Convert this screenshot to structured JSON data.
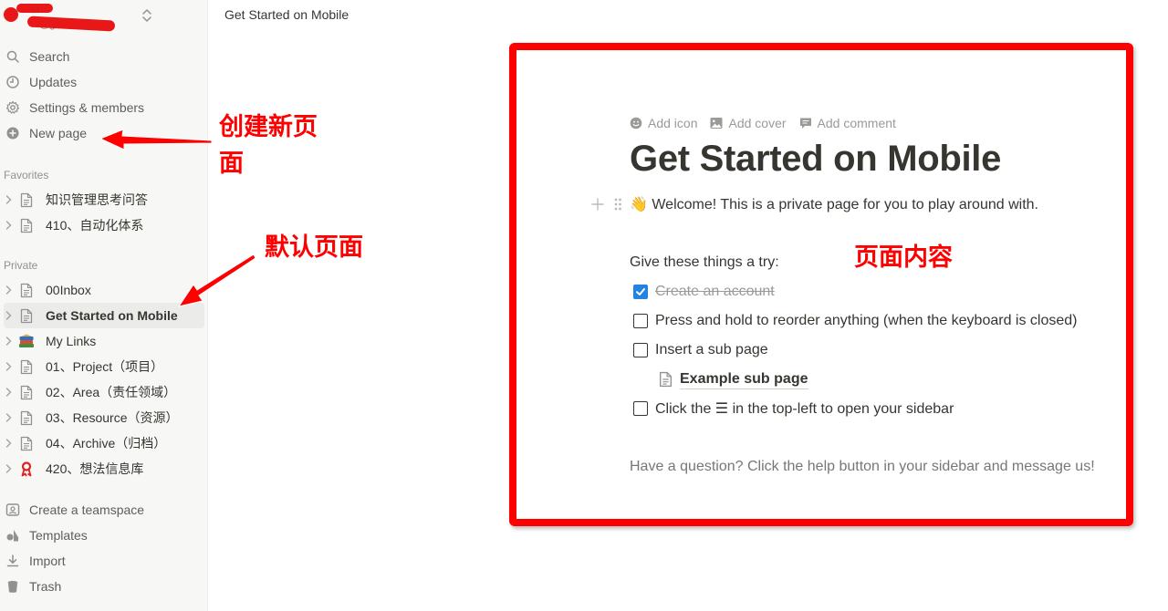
{
  "workspace": {
    "name": "M",
    "email": "...@g..."
  },
  "sidebar": {
    "nav": [
      {
        "label": "Search",
        "icon": "search-icon"
      },
      {
        "label": "Updates",
        "icon": "clock-icon"
      },
      {
        "label": "Settings & members",
        "icon": "gear-icon"
      },
      {
        "label": "New page",
        "icon": "plus-circle-icon"
      }
    ],
    "favorites_label": "Favorites",
    "favorites": [
      {
        "label": "知识管理思考问答",
        "icon": "page-icon"
      },
      {
        "label": "410、自动化体系",
        "icon": "page-icon"
      }
    ],
    "private_label": "Private",
    "private": [
      {
        "label": "00Inbox",
        "icon": "page-icon"
      },
      {
        "label": "Get Started on Mobile",
        "icon": "page-icon",
        "active": true
      },
      {
        "label": "My Links",
        "icon": "books-icon"
      },
      {
        "label": "01、Project（项目）",
        "icon": "page-icon"
      },
      {
        "label": "02、Area（责任领域）",
        "icon": "page-icon"
      },
      {
        "label": "03、Resource（资源）",
        "icon": "page-icon"
      },
      {
        "label": "04、Archive（归档）",
        "icon": "page-icon"
      },
      {
        "label": "420、想法信息库",
        "icon": "ribbon-icon"
      }
    ],
    "footer": [
      {
        "label": "Create a teamspace",
        "icon": "teamspace-icon"
      },
      {
        "label": "Templates",
        "icon": "templates-icon"
      },
      {
        "label": "Import",
        "icon": "import-icon"
      },
      {
        "label": "Trash",
        "icon": "trash-icon"
      }
    ]
  },
  "topbar": {
    "breadcrumb": "Get Started on Mobile"
  },
  "page": {
    "actions": {
      "add_icon": "Add icon",
      "add_cover": "Add cover",
      "add_comment": "Add comment"
    },
    "title": "Get Started on Mobile",
    "welcome": "👋 Welcome! This is a private page for you to play around with.",
    "try_heading": "Give these things a try:",
    "todos": [
      {
        "label": "Create an account",
        "checked": true
      },
      {
        "label": "Press and hold to reorder anything (when the keyboard is closed)",
        "checked": false
      },
      {
        "label": "Insert a sub page",
        "checked": false
      },
      {
        "label": "Click the ☰ in the top-left to open your sidebar",
        "checked": false
      }
    ],
    "subpage": "Example sub page",
    "footer": "Have a question? Click the help button in your sidebar and message us!"
  },
  "annotations": {
    "new_page_line1": "创建新页",
    "new_page_line2": "面",
    "default_page": "默认页面",
    "page_content": "页面内容"
  },
  "colors": {
    "annotation": "#ff0000",
    "checkbox_checked": "#2383e2",
    "sidebar_bg": "#f7f7f5",
    "active_item_bg": "#ebebea"
  }
}
